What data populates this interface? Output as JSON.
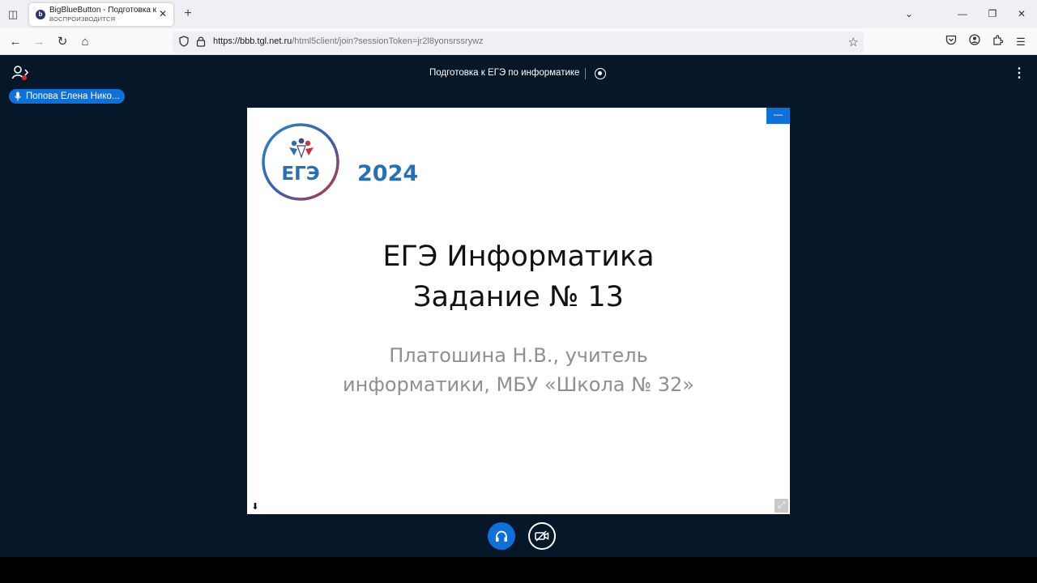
{
  "browser": {
    "tab": {
      "title": "BigBlueButton - Подготовка к ЕГЭ по информатике",
      "subtitle": "ВОСПРОИЗВОДИТСЯ",
      "favicon_letter": "b"
    },
    "url": {
      "host": "https://bbb.tgl.net.ru",
      "path": "/html5client/join?sessionToken=jr2l8yonsrssrywz"
    }
  },
  "meeting": {
    "title": "Подготовка к ЕГЭ по информатике",
    "talker": "Попова Елена Нико..."
  },
  "slide": {
    "logo_text": "ЕГЭ",
    "year": "2024",
    "title_line1": "ЕГЭ Информатика",
    "title_line2": "Задание № 13",
    "author_line1": "Платошина Н.В., учитель",
    "author_line2": "информатики, МБУ «Школа № 32»"
  },
  "colors": {
    "app_bg": "#06172a",
    "accent": "#0f70d7",
    "logo_blue": "#2a6fb0",
    "logo_red": "#c8323c"
  }
}
